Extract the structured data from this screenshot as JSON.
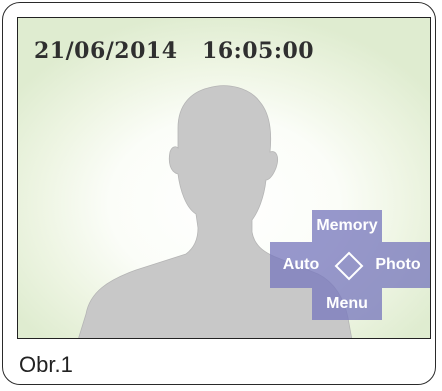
{
  "screen": {
    "datetime": "21/06/2014   16:05:00"
  },
  "navigation": {
    "up_label": "Memory",
    "left_label": "Auto",
    "right_label": "Photo",
    "down_label": "Menu",
    "center_icon": "diamond-outline-icon"
  },
  "silhouette": {
    "icon": "person-silhouette"
  },
  "caption": {
    "text": "Obr.1"
  },
  "colors": {
    "nav_panel": "#7a7abe",
    "screen_edge": "#dfecd0",
    "silhouette": "#c8c8c8"
  }
}
